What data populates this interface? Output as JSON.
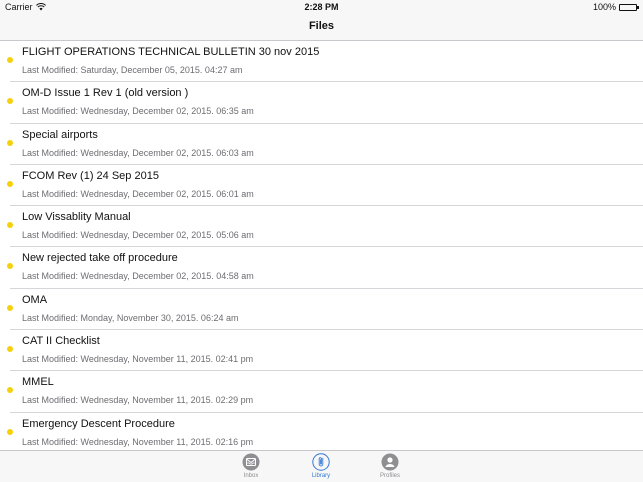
{
  "status_bar": {
    "carrier": "Carrier",
    "time": "2:28 PM",
    "battery": "100%"
  },
  "nav": {
    "title": "Files"
  },
  "files": [
    {
      "name": "FLIGHT OPERATIONS TECHNICAL BULLETIN  30 nov 2015",
      "modified": "Last Modified: Saturday, December 05, 2015. 04:27 am"
    },
    {
      "name": "OM-D Issue 1 Rev 1 (old version )",
      "modified": "Last Modified: Wednesday, December 02, 2015. 06:35 am"
    },
    {
      "name": "Special airports",
      "modified": "Last Modified: Wednesday, December 02, 2015. 06:03 am"
    },
    {
      "name": "FCOM Rev (1) 24 Sep 2015",
      "modified": "Last Modified: Wednesday, December 02, 2015. 06:01 am"
    },
    {
      "name": "Low Vissablity Manual",
      "modified": "Last Modified: Wednesday, December 02, 2015. 05:06 am"
    },
    {
      "name": "New rejected take off procedure",
      "modified": "Last Modified: Wednesday, December 02, 2015. 04:58 am"
    },
    {
      "name": "OMA",
      "modified": "Last Modified: Monday, November 30, 2015. 06:24 am"
    },
    {
      "name": "CAT II Checklist",
      "modified": "Last Modified: Wednesday, November 11, 2015. 02:41 pm"
    },
    {
      "name": "MMEL",
      "modified": "Last Modified: Wednesday, November 11, 2015. 02:29 pm"
    },
    {
      "name": "Emergency Descent Procedure",
      "modified": "Last Modified: Wednesday, November 11, 2015. 02:16 pm"
    }
  ],
  "tabs": [
    {
      "label": "Inbox",
      "icon": "inbox-icon",
      "active": false
    },
    {
      "label": "Library",
      "icon": "paperclip-icon",
      "active": true
    },
    {
      "label": "Profiles",
      "icon": "profile-icon",
      "active": false
    }
  ],
  "colors": {
    "unread_dot": "#f5d10d",
    "accent": "#3478d6",
    "inactive_tab": "#8e8e93"
  }
}
